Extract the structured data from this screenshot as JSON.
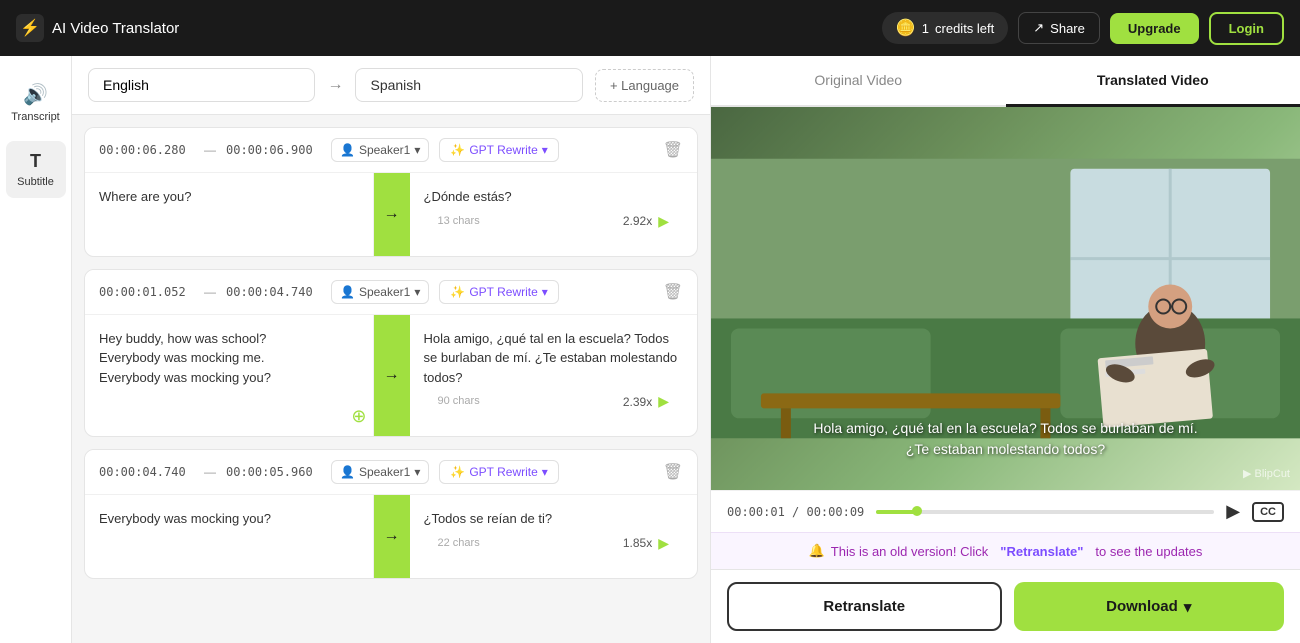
{
  "header": {
    "app_name": "AI Video Translator",
    "credits_count": "1",
    "credits_label": "credits left",
    "share_label": "Share",
    "upgrade_label": "Upgrade",
    "login_label": "Login"
  },
  "sidebar": {
    "items": [
      {
        "id": "transcript",
        "label": "Transcript",
        "icon": "🔊"
      },
      {
        "id": "subtitle",
        "label": "Subtitle",
        "icon": "T"
      }
    ]
  },
  "language_bar": {
    "source_language": "English",
    "target_language": "Spanish",
    "arrow": "→",
    "add_language": "+ Language"
  },
  "entries": [
    {
      "id": 1,
      "time_start": "00:00:06.280",
      "time_end": "00:00:06.900",
      "speaker": "Speaker1",
      "gpt_label": "GPT Rewrite",
      "original_text": "Where are you?",
      "translated_text": "¿Dónde estás?",
      "char_count": "13 chars",
      "speed": "2.92x"
    },
    {
      "id": 2,
      "time_start": "00:00:01.052",
      "time_end": "00:00:04.740",
      "speaker": "Speaker1",
      "gpt_label": "GPT Rewrite",
      "original_text": "Hey buddy, how was school?\nEverybody was mocking me.\nEverybody was mocking you?",
      "translated_text": "Hola amigo, ¿qué tal en la escuela? Todos se burlaban de mí. ¿Te estaban molestando todos?",
      "char_count": "90 chars",
      "speed": "2.39x"
    },
    {
      "id": 3,
      "time_start": "00:00:04.740",
      "time_end": "00:00:05.960",
      "speaker": "Speaker1",
      "gpt_label": "GPT Rewrite",
      "original_text": "Everybody was mocking you?",
      "translated_text": "¿Todos se reían de ti?",
      "char_count": "22 chars",
      "speed": "1.85x"
    }
  ],
  "video_panel": {
    "tab_original": "Original Video",
    "tab_translated": "Translated Video",
    "subtitle_line1": "Hola amigo, ¿qué tal en la escuela? Todos se burlaban de mí.",
    "subtitle_line2": "¿Te estaban molestando todos?",
    "watermark": "BlipCut",
    "time_current": "00:00:01",
    "time_total": "00:00:09",
    "progress_pct": 12,
    "retranslate_notice": "This is an old version! Click",
    "retranslate_link": "\"Retranslate\"",
    "retranslate_suffix": "to see the updates",
    "retranslate_btn": "Retranslate",
    "download_btn": "Download"
  }
}
